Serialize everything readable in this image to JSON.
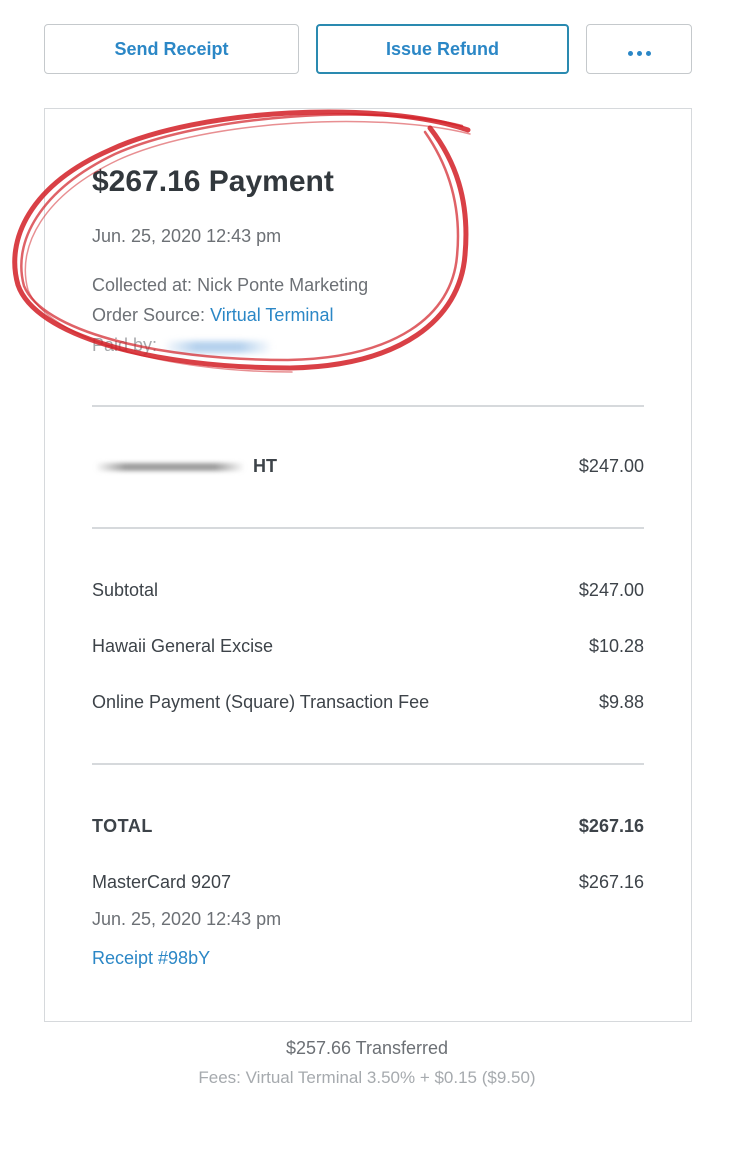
{
  "toolbar": {
    "send_receipt_label": "Send Receipt",
    "issue_refund_label": "Issue Refund",
    "more_icon": "more-horizontal-icon"
  },
  "payment": {
    "title": "$267.16 Payment",
    "datetime": "Jun. 25, 2020 12:43 pm",
    "collected_label": "Collected at:",
    "collected_value": "Nick Ponte Marketing",
    "order_source_label": "Order Source:",
    "order_source_value": "Virtual Terminal",
    "paid_by_label": "Paid by:"
  },
  "item": {
    "name_suffix": "HT",
    "amount": "$247.00"
  },
  "summary": [
    {
      "label": "Subtotal",
      "amount": "$247.00"
    },
    {
      "label": "Hawaii General Excise",
      "amount": "$10.28"
    },
    {
      "label": "Online Payment (Square) Transaction Fee",
      "amount": "$9.88"
    }
  ],
  "total": {
    "label": "TOTAL",
    "amount": "$267.16",
    "card_label": "MasterCard 9207",
    "card_amount": "$267.16",
    "card_datetime": "Jun. 25, 2020 12:43 pm",
    "receipt_link": "Receipt #98bY"
  },
  "footer": {
    "transferred": "$257.66 Transferred",
    "fees": "Fees: Virtual Terminal 3.50% + $0.15 ($9.50)"
  },
  "colors": {
    "accent": "#2b87c6",
    "annotation": "#d21f26"
  }
}
